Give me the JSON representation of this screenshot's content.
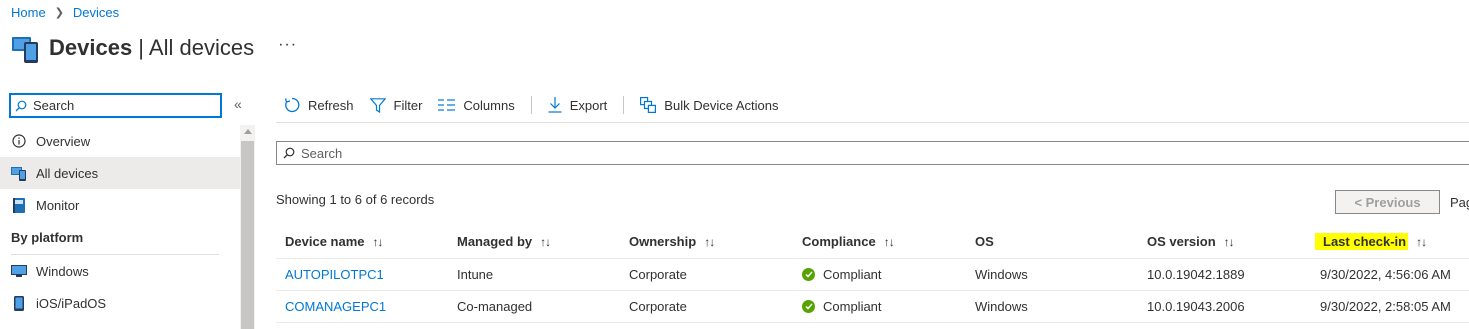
{
  "breadcrumb": {
    "home": "Home",
    "current": "Devices"
  },
  "header": {
    "title_bold": "Devices",
    "title_rest": " | All devices",
    "more": "···"
  },
  "nav": {
    "search_placeholder": "Search",
    "collapse": "«",
    "items": [
      {
        "label": "Overview",
        "icon": "info-icon"
      },
      {
        "label": "All devices",
        "icon": "devices-icon",
        "active": true
      },
      {
        "label": "Monitor",
        "icon": "monitor-book-icon"
      }
    ],
    "section": "By platform",
    "platform_items": [
      {
        "label": "Windows",
        "icon": "windows-device-icon"
      },
      {
        "label": "iOS/iPadOS",
        "icon": "phone-icon"
      }
    ]
  },
  "toolbar": {
    "refresh": "Refresh",
    "filter": "Filter",
    "columns": "Columns",
    "export": "Export",
    "bulk": "Bulk Device Actions"
  },
  "search": {
    "placeholder": "Search"
  },
  "records": "Showing 1 to 6 of 6 records",
  "pager": {
    "previous": "< Previous",
    "page": "Page"
  },
  "table": {
    "columns": [
      "Device name",
      "Managed by",
      "Ownership",
      "Compliance",
      "OS",
      "OS version",
      "Last check-in"
    ],
    "rows": [
      {
        "device": "AUTOPILOTPC1",
        "managed": "Intune",
        "ownership": "Corporate",
        "compliance": "Compliant",
        "os": "Windows",
        "version": "10.0.19042.1889",
        "checkin": "9/30/2022, 4:56:06 AM"
      },
      {
        "device": "COMANAGEPC1",
        "managed": "Co-managed",
        "ownership": "Corporate",
        "compliance": "Compliant",
        "os": "Windows",
        "version": "10.0.19043.2006",
        "checkin": "9/30/2022, 2:58:05 AM"
      }
    ]
  },
  "colors": {
    "accent": "#0078d4",
    "compliant": "#57a300",
    "highlight": "#ffff00"
  }
}
